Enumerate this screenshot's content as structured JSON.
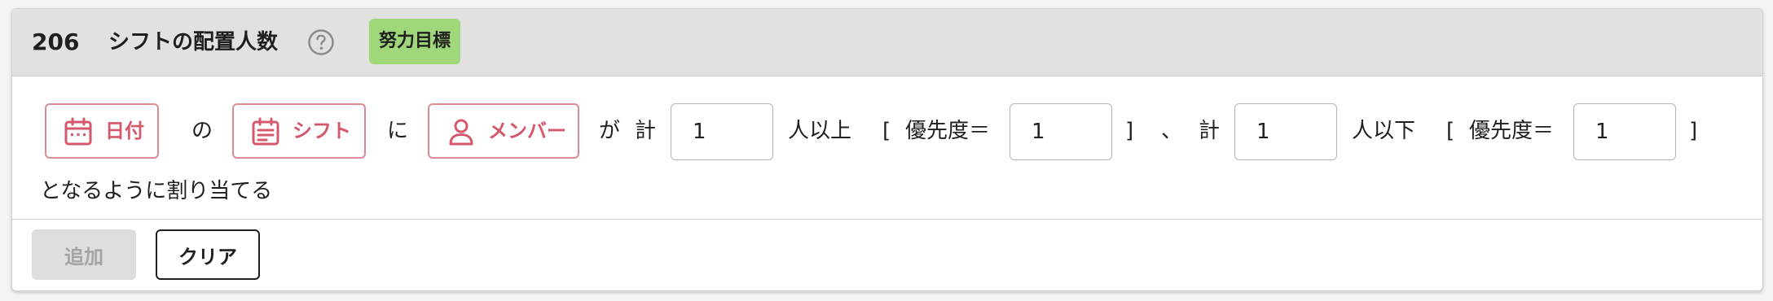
{
  "rule": {
    "number": "206",
    "title": "シフトの配置人数",
    "badge": "努力目標"
  },
  "chips": {
    "date": "日付",
    "shift": "シフト",
    "member": "メンバー"
  },
  "sentence": {
    "no": "の",
    "ni": "に",
    "ga": "が",
    "total1": "計",
    "min_suffix": "人以上",
    "bracket_open1": "[",
    "priority1": "優先度＝",
    "bracket_close1": "]",
    "comma": "、",
    "total2": "計",
    "max_suffix": "人以下",
    "bracket_open2": "[",
    "priority2": "優先度＝",
    "bracket_close2": "]",
    "ending": "となるように割り当てる"
  },
  "inputs": {
    "min_count": "1",
    "min_priority": "1",
    "max_count": "1",
    "max_priority": "1"
  },
  "buttons": {
    "add": "追加",
    "clear": "クリア"
  },
  "colors": {
    "header_bg": "#e1e1e1",
    "badge_bg": "#9fd77a",
    "chip_accent": "#d5586c"
  },
  "icons": {
    "help": "help-circle-icon",
    "date": "calendar-icon",
    "shift": "calendar-list-icon",
    "member": "person-icon"
  }
}
